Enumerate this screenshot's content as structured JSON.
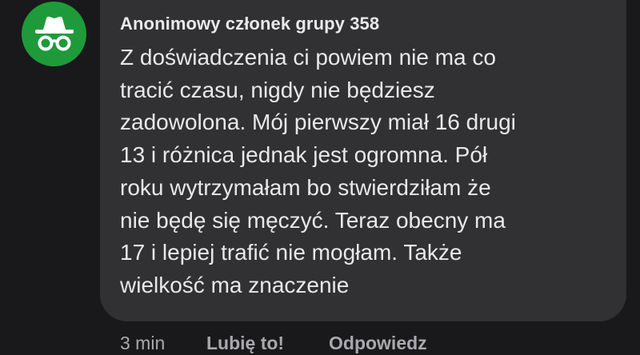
{
  "comment": {
    "avatar_icon": "incognito-hat-glasses-icon",
    "avatar_color": "#1f9a3a",
    "author": "Anonimowy członek grupy 358",
    "text": "Z doświadczenia ci powiem nie ma co\ntracić czasu, nigdy nie będziesz\nzadowolona. Mój pierwszy miał 16 drugi\n13 i różnica jednak jest ogromna. Pół\nroku wytrzymałam bo stwierdziłam że\nnie będę się męczyć. Teraz obecny ma\n17 i lepiej trafić nie mogłam. Także\nwielkość ma znaczenie",
    "time": "3 min",
    "like_label": "Lubię to!",
    "reply_label": "Odpowiedz"
  }
}
